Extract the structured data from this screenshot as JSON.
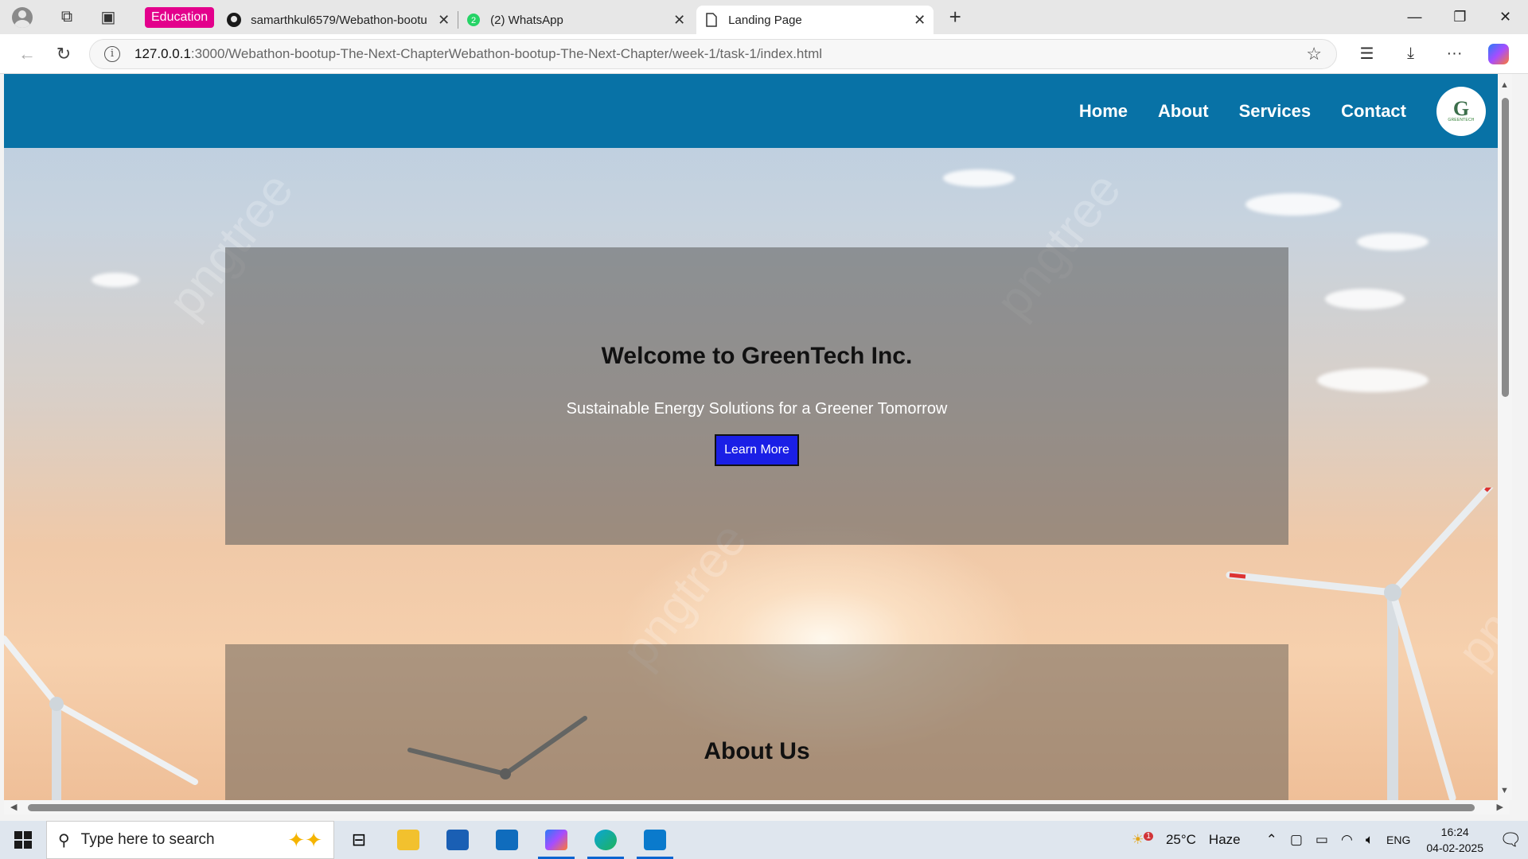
{
  "browser": {
    "tab_group": "Education",
    "tabs": [
      {
        "title": "samarthkul6579/Webathon-bootu",
        "close": "✕"
      },
      {
        "title": "(2) WhatsApp",
        "badge": "2",
        "close": "✕"
      },
      {
        "title": "Landing Page",
        "close": "✕"
      }
    ],
    "new_tab": "+",
    "url_host": "127.0.0.1",
    "url_rest": ":3000/Webathon-bootup-The-Next-ChapterWebathon-bootup-The-Next-Chapter/week-1/task-1/index.html"
  },
  "site": {
    "nav": [
      "Home",
      "About",
      "Services",
      "Contact"
    ],
    "logo_text": "GREENTECH",
    "hero_title": "Welcome to GreenTech Inc.",
    "hero_subtitle": "Sustainable Energy Solutions for a Greener Tomorrow",
    "hero_button": "Learn More",
    "about_title": "About Us",
    "watermark": "pngtree"
  },
  "taskbar": {
    "search_placeholder": "Type here to search",
    "weather_temp": "25°C",
    "weather_desc": "Haze",
    "weather_badge": "1",
    "language": "ENG",
    "time": "16:24",
    "date": "04-02-2025"
  }
}
